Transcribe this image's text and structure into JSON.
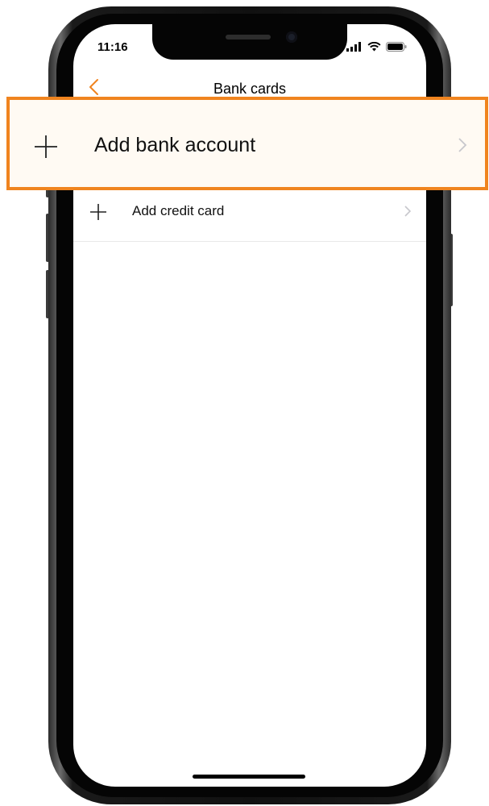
{
  "status_bar": {
    "time": "11:16",
    "icons": [
      "signal-icon",
      "wifi-icon",
      "battery-icon"
    ]
  },
  "nav": {
    "title": "Bank cards",
    "back_icon": "chevron-left-icon"
  },
  "rows": [
    {
      "label": "Add bank account",
      "icon": "plus-icon",
      "trailing_icon": "chevron-right-icon",
      "highlighted": true
    },
    {
      "label": "Add credit card",
      "icon": "plus-icon",
      "trailing_icon": "chevron-right-icon",
      "highlighted": false
    }
  ],
  "colors": {
    "accent": "#f0841f",
    "highlight_border": "#f0841f",
    "text": "#111111",
    "chevron": "#c7c7cc",
    "separator": "#e8e8e8"
  }
}
